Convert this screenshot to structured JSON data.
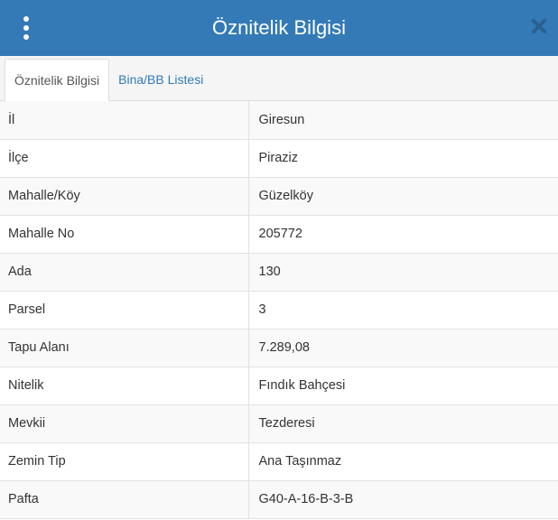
{
  "header": {
    "title": "Öznitelik Bilgisi",
    "menu_icon": "vertical-dots-icon",
    "close_icon": "close-icon"
  },
  "tabs": [
    {
      "label": "Öznitelik Bilgisi",
      "active": true
    },
    {
      "label": "Bina/BB Listesi",
      "active": false
    }
  ],
  "attributes": [
    {
      "label": "İl",
      "value": "Giresun"
    },
    {
      "label": "İlçe",
      "value": "Piraziz"
    },
    {
      "label": "Mahalle/Köy",
      "value": "Güzelköy"
    },
    {
      "label": "Mahalle No",
      "value": "205772"
    },
    {
      "label": "Ada",
      "value": "130"
    },
    {
      "label": "Parsel",
      "value": "3"
    },
    {
      "label": "Tapu Alanı",
      "value": "7.289,08"
    },
    {
      "label": "Nitelik",
      "value": "Fındık Bahçesi"
    },
    {
      "label": "Mevkii",
      "value": "Tezderesi"
    },
    {
      "label": "Zemin Tip",
      "value": "Ana Taşınmaz"
    },
    {
      "label": "Pafta",
      "value": "G40-A-16-B-3-B"
    }
  ],
  "colors": {
    "header_bg": "#337ab7",
    "header_text": "#ffffff",
    "tab_link": "#337ab7",
    "close_icon": "#2a5f8f"
  }
}
